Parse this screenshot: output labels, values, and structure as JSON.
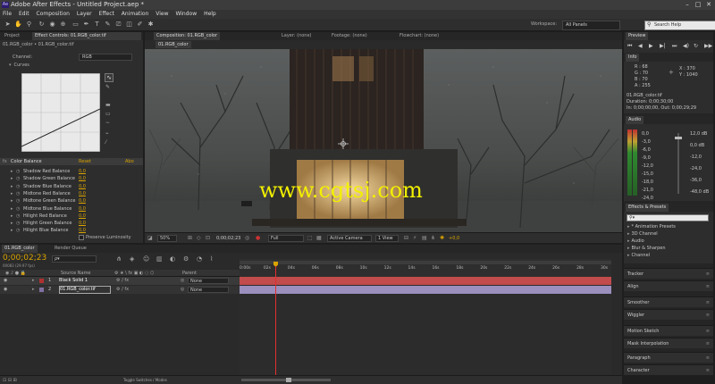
{
  "window": {
    "title": "Adobe After Effects - Untitled Project.aep *",
    "app_badge": "Ae",
    "min": "–",
    "max": "□",
    "close": "✕"
  },
  "menu": [
    "File",
    "Edit",
    "Composition",
    "Layer",
    "Effect",
    "Animation",
    "View",
    "Window",
    "Help"
  ],
  "toolbar": {
    "workspace_label": "Workspace:",
    "workspace_value": "All Panels",
    "search_placeholder": "Search Help"
  },
  "left_panel": {
    "tab_project": "Project",
    "tab_effect": "Effect Controls: 01.RGB_color.tif",
    "breadcrumb": "01.RGB_color • 01.RGB_color.tif",
    "channel_label": "Channel:",
    "channel_value": "RGB",
    "curves_label": "Curves",
    "color_balance": {
      "name": "Color Balance",
      "reset": "Reset",
      "about": "Abo",
      "params": [
        {
          "label": "Shadow Red Balance",
          "value": "0,0"
        },
        {
          "label": "Shadow Green Balance",
          "value": "0,0"
        },
        {
          "label": "Shadow Blue Balance",
          "value": "0,0"
        },
        {
          "label": "Midtone Red Balance",
          "value": "0,0"
        },
        {
          "label": "Midtone Green Balance",
          "value": "0,0"
        },
        {
          "label": "Midtone Blue Balance",
          "value": "0,0"
        },
        {
          "label": "Hilight Red Balance",
          "value": "0,0"
        },
        {
          "label": "Hilight Green Balance",
          "value": "0,0"
        },
        {
          "label": "Hilight Blue Balance",
          "value": "0,0"
        }
      ],
      "preserve": "Preserve Luminosity"
    }
  },
  "viewer": {
    "tab_comp": "Composition: 01.RGB_color",
    "tab_layer": "Layer: (none)",
    "tab_footage": "Footage: (none)",
    "tab_flowchart": "Flowchart: (none)",
    "comp_button": "01.RGB_color",
    "watermark": "www.cgtsj.com",
    "zoom": "50%",
    "timecode": "0;00;02;23",
    "resolution": "Full",
    "camera": "Active Camera",
    "view": "1 View",
    "exposure": "+0,0"
  },
  "info": {
    "title": "Info",
    "r": "R : 68",
    "g": "G : 70",
    "b": "B : 70",
    "a": "A : 255",
    "x": "X : 370",
    "y": "Y : 1040",
    "file": "01.RGB_color.tif",
    "duration": "Duration: 0;00;30;00",
    "inout": "In: 0;00;00;00, Out: 0;00;29;29"
  },
  "preview_title": "Preview",
  "audio": {
    "title": "Audio",
    "left_scale": [
      "0,0",
      "-3,0",
      "-6,0",
      "-9,0",
      "-12,0",
      "-15,0",
      "-18,0",
      "-21,0",
      "-24,0"
    ],
    "right_scale": [
      "12,0 dB",
      "0,0 dB",
      "-12,0",
      "-24,0",
      "-36,0",
      "-48,0 dB"
    ]
  },
  "effects_presets": {
    "title": "Effects & Presets",
    "items": [
      "* Animation Presets",
      "3D Channel",
      "Audio",
      "Blur & Sharpen",
      "Channel"
    ]
  },
  "right_tabs": [
    "Tracker",
    "Align",
    "Smoother",
    "Wiggler",
    "Motion Sketch",
    "Mask Interpolation",
    "Paragraph",
    "Character"
  ],
  "timeline": {
    "tab_comp": "01.RGB_color",
    "tab_render": "Render Queue",
    "timecode": "0;00;02;23",
    "frames": "00083 (29.97 fps)",
    "search_placeholder": "ρ▾",
    "header_source": "Source Name",
    "header_parent": "Parent",
    "ruler": [
      "0:00s",
      "02s",
      "04s",
      "06s",
      "08s",
      "10s",
      "12s",
      "14s",
      "16s",
      "18s",
      "20s",
      "22s",
      "24s",
      "26s",
      "28s",
      "30s"
    ],
    "layers": [
      {
        "num": "1",
        "name": "Black Solid 1",
        "parent": "None",
        "color": "#b03030"
      },
      {
        "num": "2",
        "name": "01.RGB_color.tif",
        "parent": "None",
        "color": "#8070a0"
      }
    ],
    "toggle": "Toggle Switches / Modes"
  },
  "colors": {
    "accent": "#d9a300",
    "watermark": "#f2f000",
    "track1": "#c24b4b",
    "track2": "#9b8fbd",
    "playhead": "#e03030"
  }
}
